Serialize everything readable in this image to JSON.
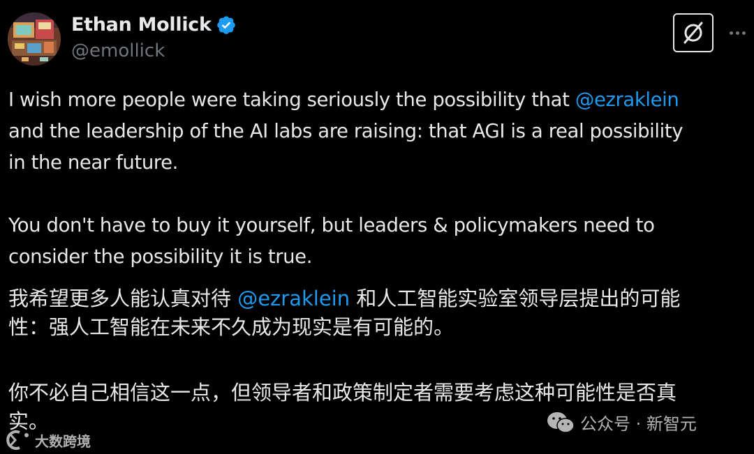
{
  "author": {
    "display_name": "Ethan Mollick",
    "handle": "@emollick",
    "verified_icon": "verified-badge-icon",
    "avatar_icon": "pixel-art-avatar"
  },
  "actions": {
    "grok_icon": "grok-icon",
    "more_icon": "more-icon"
  },
  "content": {
    "en_p1": {
      "line1_text": "I wish more people were taking seriously the possibility that ",
      "line1_mention": "@ezraklein",
      "line2": "and the leadership of the AI labs are raising: that AGI is a real possibility",
      "line3": "in the near future."
    },
    "en_p2": {
      "line1": "You don't have to buy it yourself, but leaders & policymakers need to",
      "line2": "consider the possibility it is true."
    },
    "zh_p1": {
      "line1_pre": "我希望更多人能认真对待 ",
      "line1_mention": "@ezraklein",
      "line1_post": " 和人工智能实验室领导层提出的可能",
      "line2": "性：强人工智能在未来不久成为现实是有可能的。"
    },
    "zh_p2": {
      "line1": "你不必自己相信这一点，但领导者和政策制定者需要考虑这种可能性是否真",
      "line2": "实。"
    }
  },
  "watermarks": {
    "right_text": "公众号 · 新智元",
    "right_icon": "wechat-icon",
    "left_text": "大数跨境",
    "left_icon": "dashu-logo-icon"
  },
  "colors": {
    "background": "#000000",
    "text": "#e7e9ea",
    "secondary": "#71767b",
    "link": "#1d9bf0",
    "verified": "#1d9bf0"
  }
}
